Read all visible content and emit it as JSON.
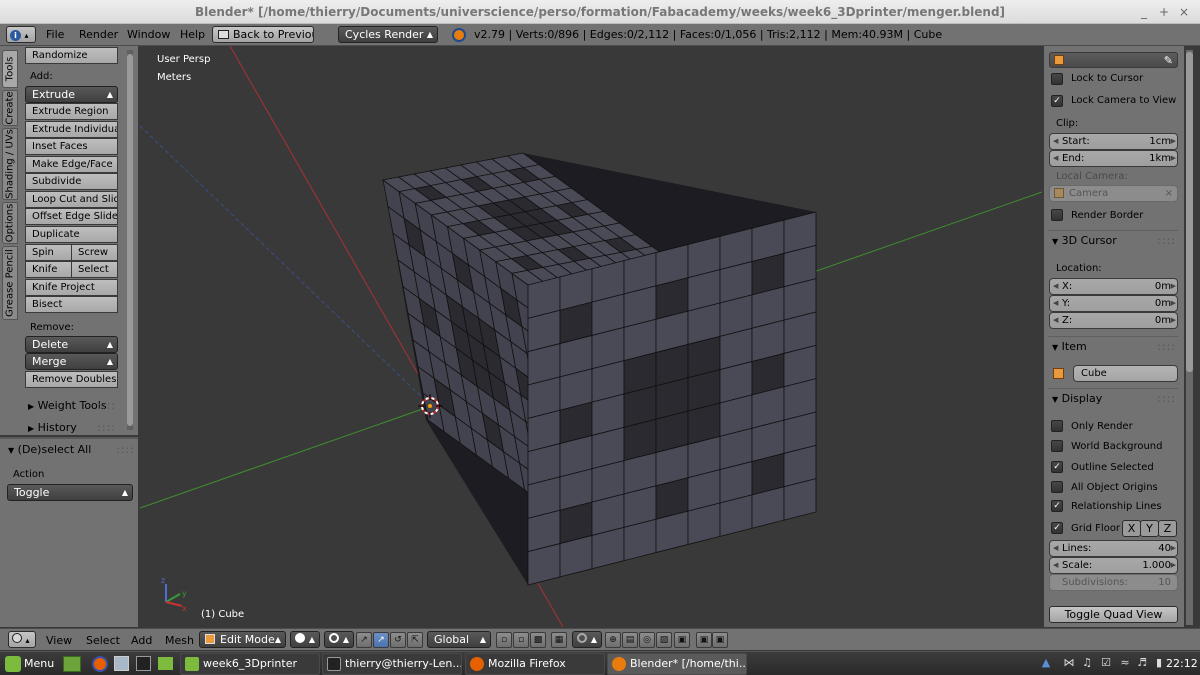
{
  "window": {
    "title": "Blender* [/home/thierry/Documents/universcience/perso/formation/Fabacademy/weeks/week6_3Dprinter/menger.blend]",
    "min": "_",
    "max": "+",
    "close": "×"
  },
  "menubar": {
    "info_icon": "i",
    "menus": [
      "File",
      "Render",
      "Window",
      "Help"
    ],
    "back_button": "Back to Previous",
    "render_engine": "Cycles Render",
    "stats": "v2.79 | Verts:0/896 | Edges:0/2,112 | Faces:0/1,056 | Tris:2,112 | Mem:40.93M | Cube"
  },
  "tabs": [
    "Tools",
    "Create",
    "Shading / UVs",
    "Options",
    "Grease Pencil"
  ],
  "toolshelf": {
    "randomize": "Randomize",
    "add_label": "Add:",
    "extrude": "Extrude",
    "extrude_region": "Extrude Region",
    "extrude_individual": "Extrude Individual",
    "inset_faces": "Inset Faces",
    "make_edge_face": "Make Edge/Face",
    "subdivide": "Subdivide",
    "loop_cut": "Loop Cut and Slide",
    "offset_edge": "Offset Edge Slide",
    "duplicate": "Duplicate",
    "spin": "Spin",
    "screw": "Screw",
    "knife": "Knife",
    "select": "Select",
    "knife_project": "Knife Project",
    "bisect": "Bisect",
    "remove_label": "Remove:",
    "delete": "Delete",
    "merge": "Merge",
    "remove_doubles": "Remove Doubles",
    "weight_tools": "Weight Tools",
    "history": "History",
    "dots": "::::"
  },
  "operator": {
    "title": "(De)select All",
    "action_label": "Action",
    "action_value": "Toggle",
    "dots": "::::"
  },
  "viewport": {
    "persp": "User Persp",
    "units": "Meters",
    "object": "(1) Cube",
    "axis_x": "x",
    "axis_y": "y",
    "axis_z": "z"
  },
  "npanel": {
    "lock_to_cursor": "Lock to Cursor",
    "lock_camera": "Lock Camera to View",
    "clip_label": "Clip:",
    "start_label": "Start:",
    "start_value": "1cm",
    "end_label": "End:",
    "end_value": "1km",
    "local_camera_label": "Local Camera:",
    "camera_value": "Camera",
    "render_border": "Render Border",
    "cursor_header": "3D Cursor",
    "location_label": "Location:",
    "x_label": "X:",
    "x_value": "0m",
    "y_label": "Y:",
    "y_value": "0m",
    "z_label": "Z:",
    "z_value": "0m",
    "item_header": "Item",
    "item_name": "Cube",
    "display_header": "Display",
    "only_render": "Only Render",
    "world_background": "World Background",
    "outline_selected": "Outline Selected",
    "all_object_origins": "All Object Origins",
    "relationship_lines": "Relationship Lines",
    "grid_floor": "Grid Floor",
    "axis_x": "X",
    "axis_y": "Y",
    "axis_z": "Z",
    "lines_label": "Lines:",
    "lines_value": "40",
    "scale_label": "Scale:",
    "scale_value": "1.000",
    "subdivisions_label": "Subdivisions:",
    "subdivisions_value": "10",
    "toggle_quad": "Toggle Quad View",
    "dots": "::::",
    "check": "✓"
  },
  "bottombar": {
    "menus": [
      "View",
      "Select",
      "Add",
      "Mesh"
    ],
    "mode": "Edit Mode",
    "orientation": "Global"
  },
  "taskbar": {
    "menu": "Menu",
    "tasks": [
      "week6_3Dprinter",
      "thierry@thierry-Len...",
      "Mozilla Firefox",
      "Blender* [/home/thi..."
    ],
    "clock": "22:12"
  },
  "colors": {
    "panel": "#727272",
    "viewport": "#393939",
    "mesh_face": "#4a4a57",
    "grid_green": "#3f8f2f",
    "axis_red": "#a83232"
  }
}
